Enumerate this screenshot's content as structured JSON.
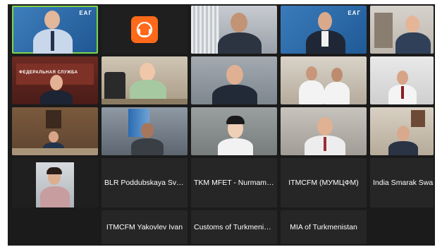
{
  "meeting": {
    "participants": [
      {
        "id": "p1",
        "label": "",
        "speaking": true
      },
      {
        "id": "p2",
        "label": "",
        "icon": "audio-only-icon"
      },
      {
        "id": "p3",
        "label": ""
      },
      {
        "id": "p4",
        "label": ""
      },
      {
        "id": "p5",
        "label": ""
      },
      {
        "id": "p6",
        "label": ""
      },
      {
        "id": "p7",
        "label": ""
      },
      {
        "id": "p8",
        "label": ""
      },
      {
        "id": "p9",
        "label": ""
      },
      {
        "id": "p10",
        "label": ""
      },
      {
        "id": "p11",
        "label": ""
      },
      {
        "id": "p12",
        "label": ""
      },
      {
        "id": "p13",
        "label": ""
      },
      {
        "id": "p14",
        "label": ""
      },
      {
        "id": "p15",
        "label": ""
      },
      {
        "id": "p16",
        "label": ""
      },
      {
        "id": "p17",
        "label": "BLR Poddubskaya Svetl..."
      },
      {
        "id": "p18",
        "label": "TKM MFET - Nurmamm..."
      },
      {
        "id": "p19",
        "label": "ITMCFM (МУМЦФМ)"
      },
      {
        "id": "p20",
        "label": "India Smarak Swain"
      },
      {
        "id": "p21",
        "label": "ITMCFM Yakovlev Ivan"
      },
      {
        "id": "p22",
        "label": "Customs of Turkmenista..."
      },
      {
        "id": "p23",
        "label": "MIA of Turkmenistan"
      }
    ],
    "room_signs": {
      "badge_1": "ЕАГ",
      "badge_4": "ЕАГ",
      "banner_6": "ФЕДЕРАЛЬНАЯ СЛУЖБА"
    },
    "colors": {
      "stage_bg": "#1b1b1b",
      "tile_bg": "#262626",
      "active_speaker": "#7dd54a",
      "audio_icon": "#ff6a1a"
    }
  }
}
